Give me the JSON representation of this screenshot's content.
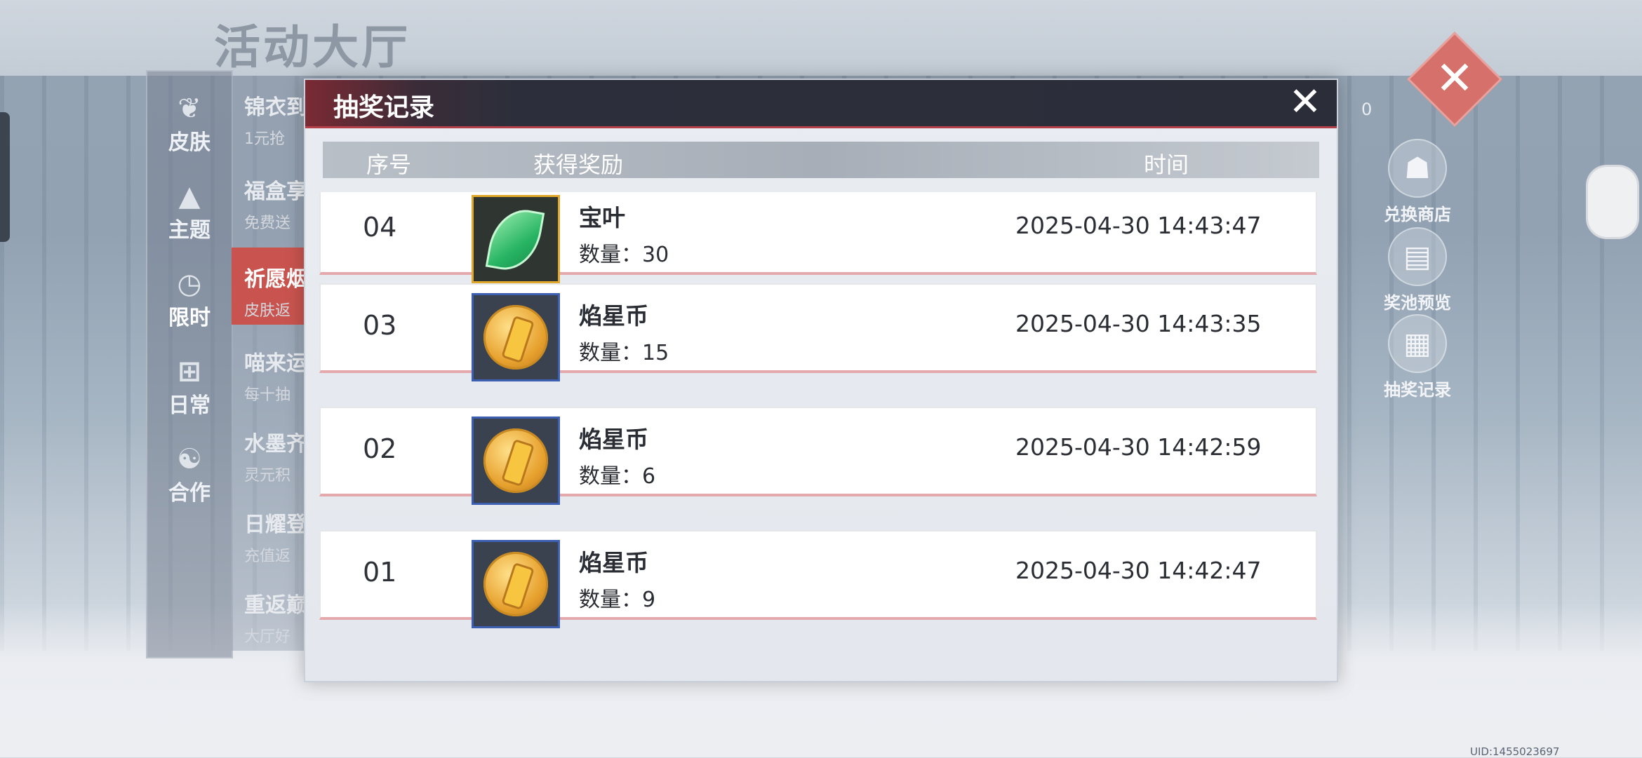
{
  "background": {
    "page_title": "活动大厅",
    "categories": [
      {
        "label": "皮肤",
        "icon": "butterfly-icon"
      },
      {
        "label": "主题",
        "icon": "mountain-icon"
      },
      {
        "label": "限时",
        "icon": "clock-icon"
      },
      {
        "label": "日常",
        "icon": "gift-icon"
      },
      {
        "label": "合作",
        "icon": "handshake-icon"
      }
    ],
    "events": [
      {
        "title": "锦衣到",
        "subtitle": "1元抢"
      },
      {
        "title": "福盒享",
        "subtitle": "免费送"
      },
      {
        "title": "祈愿烟",
        "subtitle": "皮肤返"
      },
      {
        "title": "喵来运",
        "subtitle": "每十抽"
      },
      {
        "title": "水墨齐",
        "subtitle": "灵元积"
      },
      {
        "title": "日耀登",
        "subtitle": "充值返"
      },
      {
        "title": "重返巅",
        "subtitle": "大厅好"
      }
    ],
    "counter": "0",
    "right_buttons": [
      {
        "label": "兑换商店",
        "icon": "shop-cat-icon"
      },
      {
        "label": "奖池预览",
        "icon": "document-icon"
      },
      {
        "label": "抽奖记录",
        "icon": "gift-box-icon"
      }
    ],
    "uid": "UID:1455023697"
  },
  "dialog": {
    "title": "抽奖记录",
    "close_glyph": "✕",
    "columns": {
      "index": "序号",
      "reward": "获得奖励",
      "time": "时间"
    },
    "records": [
      {
        "index": "04",
        "name": "宝叶",
        "qty": "数量：30",
        "time": "2025-04-30 14:43:47",
        "icon": "leaf-icon"
      },
      {
        "index": "03",
        "name": "焰星币",
        "qty": "数量：15",
        "time": "2025-04-30 14:43:35",
        "icon": "coin-icon"
      },
      {
        "index": "02",
        "name": "焰星币",
        "qty": "数量：6",
        "time": "2025-04-30 14:42:59",
        "icon": "coin-icon"
      },
      {
        "index": "01",
        "name": "焰星币",
        "qty": "数量：9",
        "time": "2025-04-30 14:42:47",
        "icon": "coin-icon"
      }
    ]
  }
}
